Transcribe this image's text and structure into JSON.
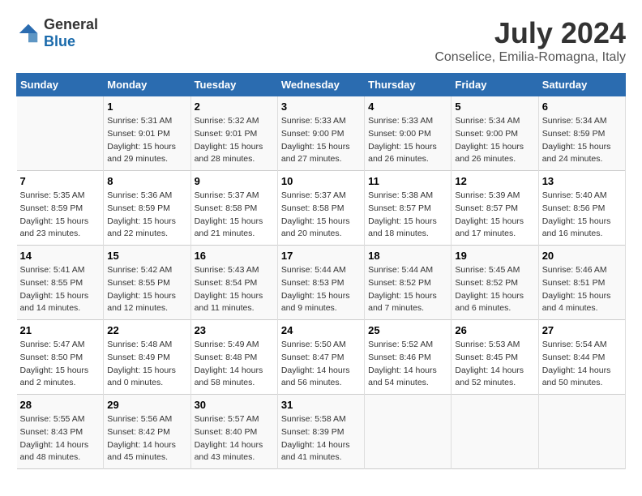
{
  "logo": {
    "general": "General",
    "blue": "Blue"
  },
  "title": "July 2024",
  "subtitle": "Conselice, Emilia-Romagna, Italy",
  "days_of_week": [
    "Sunday",
    "Monday",
    "Tuesday",
    "Wednesday",
    "Thursday",
    "Friday",
    "Saturday"
  ],
  "weeks": [
    [
      {
        "day": "",
        "info": ""
      },
      {
        "day": "1",
        "info": "Sunrise: 5:31 AM\nSunset: 9:01 PM\nDaylight: 15 hours\nand 29 minutes."
      },
      {
        "day": "2",
        "info": "Sunrise: 5:32 AM\nSunset: 9:01 PM\nDaylight: 15 hours\nand 28 minutes."
      },
      {
        "day": "3",
        "info": "Sunrise: 5:33 AM\nSunset: 9:00 PM\nDaylight: 15 hours\nand 27 minutes."
      },
      {
        "day": "4",
        "info": "Sunrise: 5:33 AM\nSunset: 9:00 PM\nDaylight: 15 hours\nand 26 minutes."
      },
      {
        "day": "5",
        "info": "Sunrise: 5:34 AM\nSunset: 9:00 PM\nDaylight: 15 hours\nand 26 minutes."
      },
      {
        "day": "6",
        "info": "Sunrise: 5:34 AM\nSunset: 8:59 PM\nDaylight: 15 hours\nand 24 minutes."
      }
    ],
    [
      {
        "day": "7",
        "info": "Sunrise: 5:35 AM\nSunset: 8:59 PM\nDaylight: 15 hours\nand 23 minutes."
      },
      {
        "day": "8",
        "info": "Sunrise: 5:36 AM\nSunset: 8:59 PM\nDaylight: 15 hours\nand 22 minutes."
      },
      {
        "day": "9",
        "info": "Sunrise: 5:37 AM\nSunset: 8:58 PM\nDaylight: 15 hours\nand 21 minutes."
      },
      {
        "day": "10",
        "info": "Sunrise: 5:37 AM\nSunset: 8:58 PM\nDaylight: 15 hours\nand 20 minutes."
      },
      {
        "day": "11",
        "info": "Sunrise: 5:38 AM\nSunset: 8:57 PM\nDaylight: 15 hours\nand 18 minutes."
      },
      {
        "day": "12",
        "info": "Sunrise: 5:39 AM\nSunset: 8:57 PM\nDaylight: 15 hours\nand 17 minutes."
      },
      {
        "day": "13",
        "info": "Sunrise: 5:40 AM\nSunset: 8:56 PM\nDaylight: 15 hours\nand 16 minutes."
      }
    ],
    [
      {
        "day": "14",
        "info": "Sunrise: 5:41 AM\nSunset: 8:55 PM\nDaylight: 15 hours\nand 14 minutes."
      },
      {
        "day": "15",
        "info": "Sunrise: 5:42 AM\nSunset: 8:55 PM\nDaylight: 15 hours\nand 12 minutes."
      },
      {
        "day": "16",
        "info": "Sunrise: 5:43 AM\nSunset: 8:54 PM\nDaylight: 15 hours\nand 11 minutes."
      },
      {
        "day": "17",
        "info": "Sunrise: 5:44 AM\nSunset: 8:53 PM\nDaylight: 15 hours\nand 9 minutes."
      },
      {
        "day": "18",
        "info": "Sunrise: 5:44 AM\nSunset: 8:52 PM\nDaylight: 15 hours\nand 7 minutes."
      },
      {
        "day": "19",
        "info": "Sunrise: 5:45 AM\nSunset: 8:52 PM\nDaylight: 15 hours\nand 6 minutes."
      },
      {
        "day": "20",
        "info": "Sunrise: 5:46 AM\nSunset: 8:51 PM\nDaylight: 15 hours\nand 4 minutes."
      }
    ],
    [
      {
        "day": "21",
        "info": "Sunrise: 5:47 AM\nSunset: 8:50 PM\nDaylight: 15 hours\nand 2 minutes."
      },
      {
        "day": "22",
        "info": "Sunrise: 5:48 AM\nSunset: 8:49 PM\nDaylight: 15 hours\nand 0 minutes."
      },
      {
        "day": "23",
        "info": "Sunrise: 5:49 AM\nSunset: 8:48 PM\nDaylight: 14 hours\nand 58 minutes."
      },
      {
        "day": "24",
        "info": "Sunrise: 5:50 AM\nSunset: 8:47 PM\nDaylight: 14 hours\nand 56 minutes."
      },
      {
        "day": "25",
        "info": "Sunrise: 5:52 AM\nSunset: 8:46 PM\nDaylight: 14 hours\nand 54 minutes."
      },
      {
        "day": "26",
        "info": "Sunrise: 5:53 AM\nSunset: 8:45 PM\nDaylight: 14 hours\nand 52 minutes."
      },
      {
        "day": "27",
        "info": "Sunrise: 5:54 AM\nSunset: 8:44 PM\nDaylight: 14 hours\nand 50 minutes."
      }
    ],
    [
      {
        "day": "28",
        "info": "Sunrise: 5:55 AM\nSunset: 8:43 PM\nDaylight: 14 hours\nand 48 minutes."
      },
      {
        "day": "29",
        "info": "Sunrise: 5:56 AM\nSunset: 8:42 PM\nDaylight: 14 hours\nand 45 minutes."
      },
      {
        "day": "30",
        "info": "Sunrise: 5:57 AM\nSunset: 8:40 PM\nDaylight: 14 hours\nand 43 minutes."
      },
      {
        "day": "31",
        "info": "Sunrise: 5:58 AM\nSunset: 8:39 PM\nDaylight: 14 hours\nand 41 minutes."
      },
      {
        "day": "",
        "info": ""
      },
      {
        "day": "",
        "info": ""
      },
      {
        "day": "",
        "info": ""
      }
    ]
  ]
}
